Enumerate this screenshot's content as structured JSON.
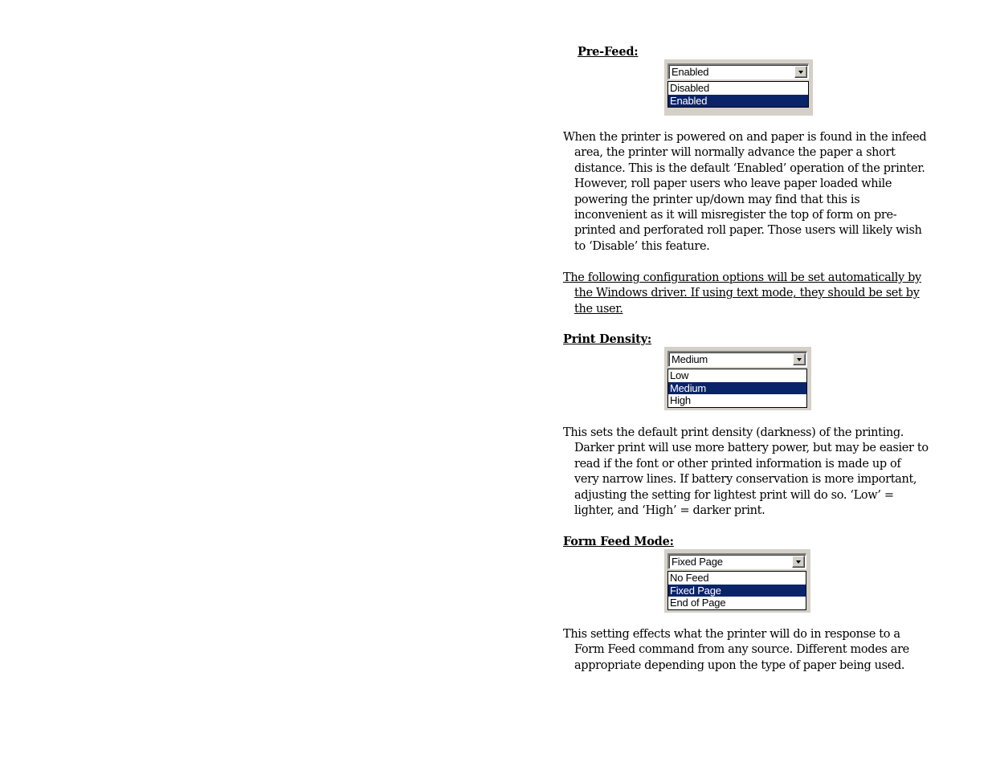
{
  "colors": {
    "selection_bg": "#0a246a",
    "selection_fg": "#ffffff",
    "dialog_face": "#d4d0c8",
    "text": "#000000"
  },
  "sections": [
    {
      "heading": "Pre-Feed:",
      "dropdown": {
        "value": "Enabled",
        "options": [
          "Disabled",
          "Enabled"
        ],
        "selected_index": 1,
        "button_icon": "chevron-down-icon"
      },
      "paragraph_lines": [
        "When the printer is powered on and paper is found in the infeed",
        "area, the printer will normally advance the paper a short",
        "distance.  This is the default ‘Enabled’ operation of the printer.",
        "However, roll paper users who leave paper loaded while",
        "powering the printer up/down may find that this is",
        "inconvenient as it will misregister the top of form on pre-",
        "printed and perforated roll paper.  Those users will likely wish",
        "to ‘Disable’ this feature."
      ]
    },
    {
      "note_lines": [
        "The following configuration options will be set automatically by",
        "the Windows driver.  If using text mode, they should be set by",
        "the user."
      ]
    },
    {
      "heading": "Print Density:",
      "dropdown": {
        "value": "Medium",
        "options": [
          "Low",
          "Medium",
          "High"
        ],
        "selected_index": 1,
        "button_icon": "chevron-down-icon"
      },
      "paragraph_lines": [
        "This sets the default print density (darkness) of the printing.",
        "Darker print will use more battery power, but may be easier to",
        "read if the font or other printed information is made up of",
        "very narrow lines.  If battery conservation is more important,",
        "adjusting the setting for lightest print will do so.  ‘Low’ =",
        "lighter, and ‘High’ = darker print."
      ]
    },
    {
      "heading": "Form Feed Mode:",
      "dropdown": {
        "value": "Fixed Page",
        "options": [
          "No Feed",
          "Fixed Page",
          "End of Page"
        ],
        "selected_index": 1,
        "button_icon": "chevron-down-icon"
      },
      "paragraph_lines": [
        "This setting effects what the printer will do in response to a",
        "Form Feed command from any source.  Different modes are",
        "appropriate depending upon the type of paper being used."
      ]
    }
  ]
}
